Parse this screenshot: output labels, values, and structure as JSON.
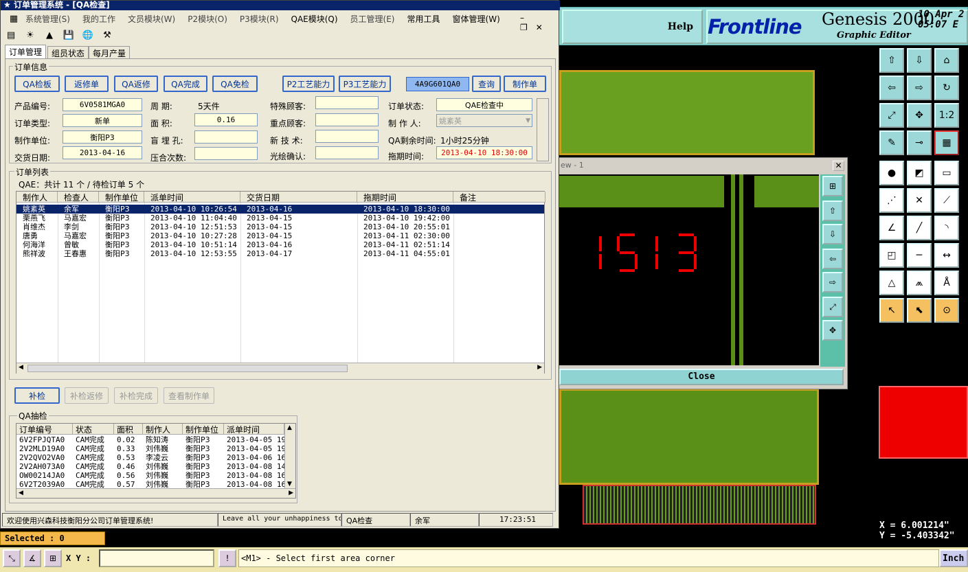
{
  "cad": {
    "help_label": "Help",
    "logo_brand": "Frontline",
    "logo_product": "Genesis 2000",
    "logo_subtitle": "Graphic Editor",
    "date_line1": "10 Apr 2",
    "date_line2": "05:07 E",
    "view_title": "ew - 1",
    "view_close_label": "Close",
    "x_coord": "X = 6.001214\"",
    "y_coord": "Y = -5.403342\"",
    "selected_label": "Selected : 0",
    "xy_label": "X Y :",
    "status_message": "<M1> - Select first area corner",
    "units_label": "Inch",
    "seg_digits": "1 5 1 3",
    "colors": {
      "pcb_green": "#6aa020",
      "pcb_gold": "#c8a020",
      "tool_cyan": "#9cd8d8",
      "header_cyan": "#8fd3d3",
      "highlight_red": "#e00000"
    }
  },
  "app": {
    "title": "订单管理系统 - [QA检查]",
    "menus": [
      "系统管理(S)",
      "我的工作",
      "文员模块(W)",
      "P2模块(O)",
      "P3模块(R)",
      "QAE模块(Q)",
      "员工管理(E)",
      "常用工具",
      "窗体管理(W)"
    ],
    "tabs": [
      "订单管理",
      "组员状态",
      "每月产量"
    ],
    "order_info": {
      "legend": "订单信息",
      "buttons": [
        "QA检板",
        "返修单",
        "QA返修",
        "QA完成",
        "QA免检",
        "P2工艺能力",
        "P3工艺能力"
      ],
      "search_value": "4A9G601QA0",
      "query_label": "查询",
      "make_order_label": "制作单",
      "fields": {
        "product_no_label": "产品编号:",
        "product_no": "6V0581MGA0",
        "period_label": "周    期:",
        "period": "5天件",
        "special_customer_label": "特殊顾客:",
        "special_customer": "",
        "order_status_label": "订单状态:",
        "order_status": "QAE检查中",
        "order_type_label": "订单类型:",
        "order_type": "新单",
        "area_label": "面    积:",
        "area": "0.16",
        "key_customer_label": "重点顾客:",
        "key_customer": "",
        "maker_label": "制 作 人:",
        "maker": "姚紊英",
        "unit_label": "制作单位:",
        "unit": "衡阳P3",
        "blind_hole_label": "盲 埋 孔:",
        "blind_hole": "",
        "new_tech_label": "新 技 术:",
        "new_tech": "",
        "remain_label": "QA剩余时间:",
        "remain": "1小时25分钟",
        "delivery_label": "交货日期:",
        "delivery": "2013-04-16",
        "press_label": "压合次数:",
        "press": "",
        "photo_label": "光绘确认:",
        "photo": "",
        "delay_label": "拖期时间:",
        "delay": "2013-04-10 18:30:00"
      }
    },
    "order_list": {
      "legend": "订单列表",
      "summary": "QAE：共计 11 个 / 待检订单 5 个",
      "columns": [
        "制作人",
        "检查人",
        "制作单位",
        "派单时间",
        "交货日期",
        "拖期时间",
        "备注"
      ],
      "rows": [
        [
          "姚紊英",
          "余军",
          "衡阳P3",
          "2013-04-10 10:26:54",
          "2013-04-16",
          "2013-04-10 18:30:00",
          ""
        ],
        [
          "栗燕飞",
          "马嘉宏",
          "衡阳P3",
          "2013-04-10 11:04:40",
          "2013-04-15",
          "2013-04-10 19:42:00",
          ""
        ],
        [
          "肖维杰",
          "李剑",
          "衡阳P3",
          "2013-04-10 12:51:53",
          "2013-04-15",
          "2013-04-10 20:55:01",
          ""
        ],
        [
          "唐勇",
          "马嘉宏",
          "衡阳P3",
          "2013-04-10 10:27:28",
          "2013-04-15",
          "2013-04-11 02:30:00",
          ""
        ],
        [
          "何海洋",
          "曾敏",
          "衡阳P3",
          "2013-04-10 10:51:14",
          "2013-04-16",
          "2013-04-11 02:51:14",
          ""
        ],
        [
          "熊祥波",
          "王春惠",
          "衡阳P3",
          "2013-04-10 12:53:55",
          "2013-04-17",
          "2013-04-11 04:55:01",
          ""
        ]
      ],
      "action_buttons": [
        "补检",
        "补检返修",
        "补检完成",
        "查看制作单"
      ]
    },
    "qa_sample": {
      "legend": "QA抽检",
      "columns": [
        "订单编号",
        "状态",
        "面积",
        "制作人",
        "制作单位",
        "派单时间"
      ],
      "rows": [
        [
          "6V2FPJQTA0",
          "CAM完成",
          "0.02",
          "陈知涛",
          "衡阳P3",
          "2013-04-05 19:"
        ],
        [
          "2V2MLD19A0",
          "CAM完成",
          "0.33",
          "刘伟巍",
          "衡阳P3",
          "2013-04-05 19:"
        ],
        [
          "2V2QVO2VA0",
          "CAM完成",
          "0.53",
          "李凌云",
          "衡阳P3",
          "2013-04-06 16:"
        ],
        [
          "2V2AH073A0",
          "CAM完成",
          "0.46",
          "刘伟巍",
          "衡阳P3",
          "2013-04-08 14:"
        ],
        [
          "OW00214JA0",
          "CAM完成",
          "0.56",
          "刘伟巍",
          "衡阳P3",
          "2013-04-08 16:"
        ],
        [
          "6V2T2039A0",
          "CAM完成",
          "0.57",
          "刘伟巍",
          "衡阳P3",
          "2013-04-08 16:"
        ]
      ]
    },
    "status_bar": {
      "welcome": "欢迎使用兴森科技衡阳分公司订单管理系统!",
      "marquee": "Leave all your unhappiness to",
      "module": "QA检查",
      "user": "余军",
      "time": "17:23:51"
    }
  }
}
